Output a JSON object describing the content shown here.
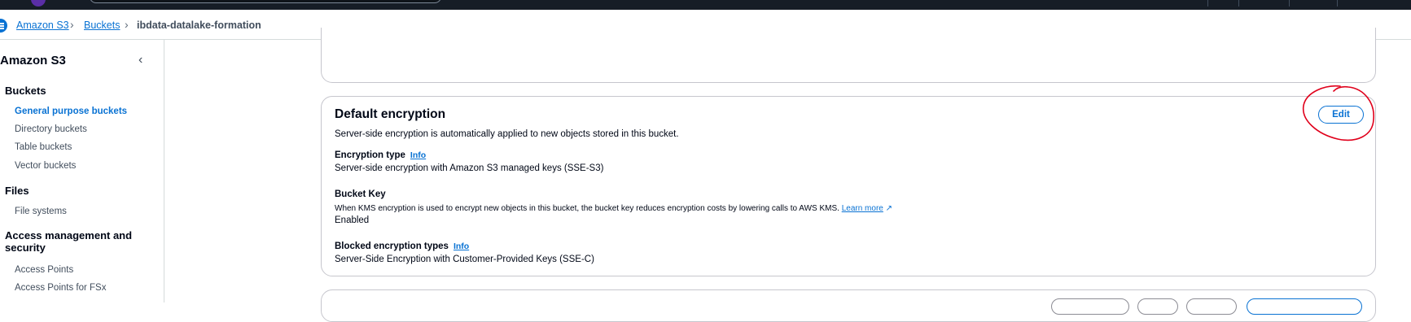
{
  "breadcrumb": {
    "items": [
      {
        "label": "Amazon S3"
      },
      {
        "label": "Buckets"
      }
    ],
    "current": "ibdata-datalake-formation"
  },
  "sidebar": {
    "title": "Amazon S3",
    "sections": [
      {
        "title": "Buckets",
        "items": [
          {
            "label": "General purpose buckets",
            "active": true
          },
          {
            "label": "Directory buckets"
          },
          {
            "label": "Table buckets"
          },
          {
            "label": "Vector buckets"
          }
        ]
      },
      {
        "title": "Files",
        "items": [
          {
            "label": "File systems"
          }
        ]
      },
      {
        "title_line1": "Access management and",
        "title_line2": "security",
        "items": [
          {
            "label": "Access Points"
          },
          {
            "label": "Access Points for FSx"
          }
        ]
      }
    ]
  },
  "encryption_panel": {
    "title": "Default encryption",
    "description": "Server-side encryption is automatically applied to new objects stored in this bucket.",
    "edit_label": "Edit",
    "encryption_type": {
      "label": "Encryption type",
      "info": "Info",
      "value": "Server-side encryption with Amazon S3 managed keys (SSE-S3)"
    },
    "bucket_key": {
      "label": "Bucket Key",
      "description": "When KMS encryption is used to encrypt new objects in this bucket, the bucket key reduces encryption costs by lowering calls to AWS KMS.",
      "learn_more": "Learn more",
      "value": "Enabled"
    },
    "blocked_types": {
      "label": "Blocked encryption types",
      "info": "Info",
      "value": "Server-Side Encryption with Customer-Provided Keys (SSE-C)"
    }
  },
  "colors": {
    "accent": "#0972d3",
    "topbar": "#161d26",
    "annotation": "#e0001b"
  }
}
